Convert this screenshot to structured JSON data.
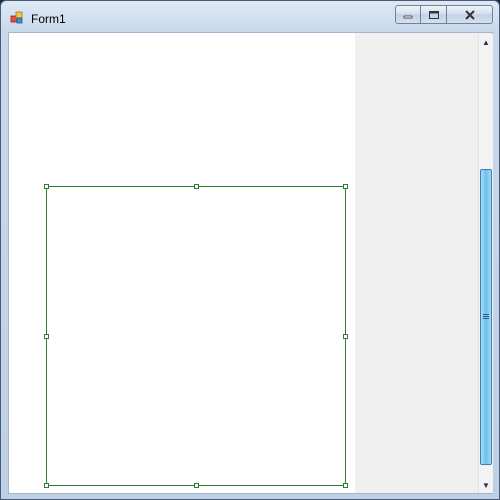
{
  "window": {
    "title": "Form1",
    "icon": "winforms-app-icon",
    "caption_buttons": [
      "minimize-icon",
      "maximize-icon",
      "close-icon"
    ]
  },
  "scrollbar": {
    "up_glyph": "▲",
    "down_glyph": "▼",
    "position": 0.72
  },
  "colors": {
    "selection_border": "#2e7d32",
    "scroll_thumb": "#6cc0ec",
    "client_background": "#f0f0f0",
    "panel_background": "#ffffff"
  }
}
